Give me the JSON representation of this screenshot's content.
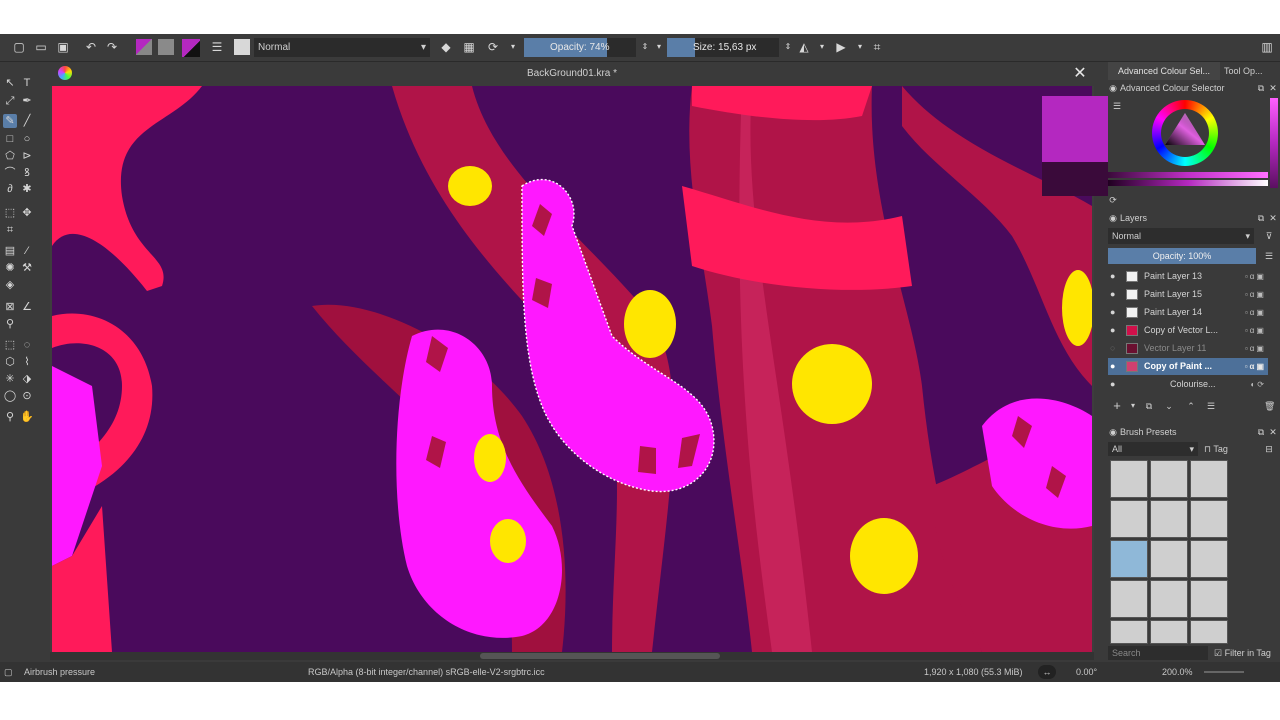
{
  "toolbar": {
    "blend_mode": "Normal",
    "opacity_label": "Opacity: 74%",
    "opacity_value": 0.74,
    "size_label": "Size: 15,63 px",
    "size_fraction": 0.25
  },
  "document": {
    "title": "BackGround01.kra *"
  },
  "colour_selector": {
    "tab_label": "Advanced Colour Sel...",
    "tab2_label": "Tool Op...",
    "panel_title": "Advanced Colour Selector",
    "foreground": "#b428c0",
    "background": "#3a0a3a"
  },
  "layers": {
    "panel_title": "Layers",
    "blend_mode": "Normal",
    "opacity_label": "Opacity:  100%",
    "items": [
      {
        "name": "Paint Layer 13",
        "visible": true,
        "selected": false
      },
      {
        "name": "Paint Layer 15",
        "visible": true,
        "selected": false
      },
      {
        "name": "Paint Layer 14",
        "visible": true,
        "selected": false
      },
      {
        "name": "Copy of Vector L...",
        "visible": true,
        "selected": false
      },
      {
        "name": "Vector Layer 11",
        "visible": false,
        "selected": false
      },
      {
        "name": "Copy of Paint ...",
        "visible": true,
        "selected": true
      },
      {
        "name": "Colourise...",
        "visible": true,
        "selected": false
      }
    ]
  },
  "brush_presets": {
    "panel_title": "Brush Presets",
    "filter": "All",
    "tag_label": "Tag",
    "search_placeholder": "Search",
    "filter_in_tag": "Filter in Tag"
  },
  "status": {
    "tool": "Airbrush pressure",
    "color_space": "RGB/Alpha (8-bit integer/channel)  sRGB-elle-V2-srgbtrc.icc",
    "dimensions": "1,920 x 1,080 (55.3 MiB)",
    "rotation": "0.00°",
    "zoom": "200.0%"
  },
  "colors": {
    "accent": "#5a7ea8",
    "canvas_bg": "#4a0a5c",
    "tentacle": "#b01448",
    "magenta": "#ff18ff",
    "yellow": "#ffe600",
    "red_pink": "#ff1a5a"
  }
}
